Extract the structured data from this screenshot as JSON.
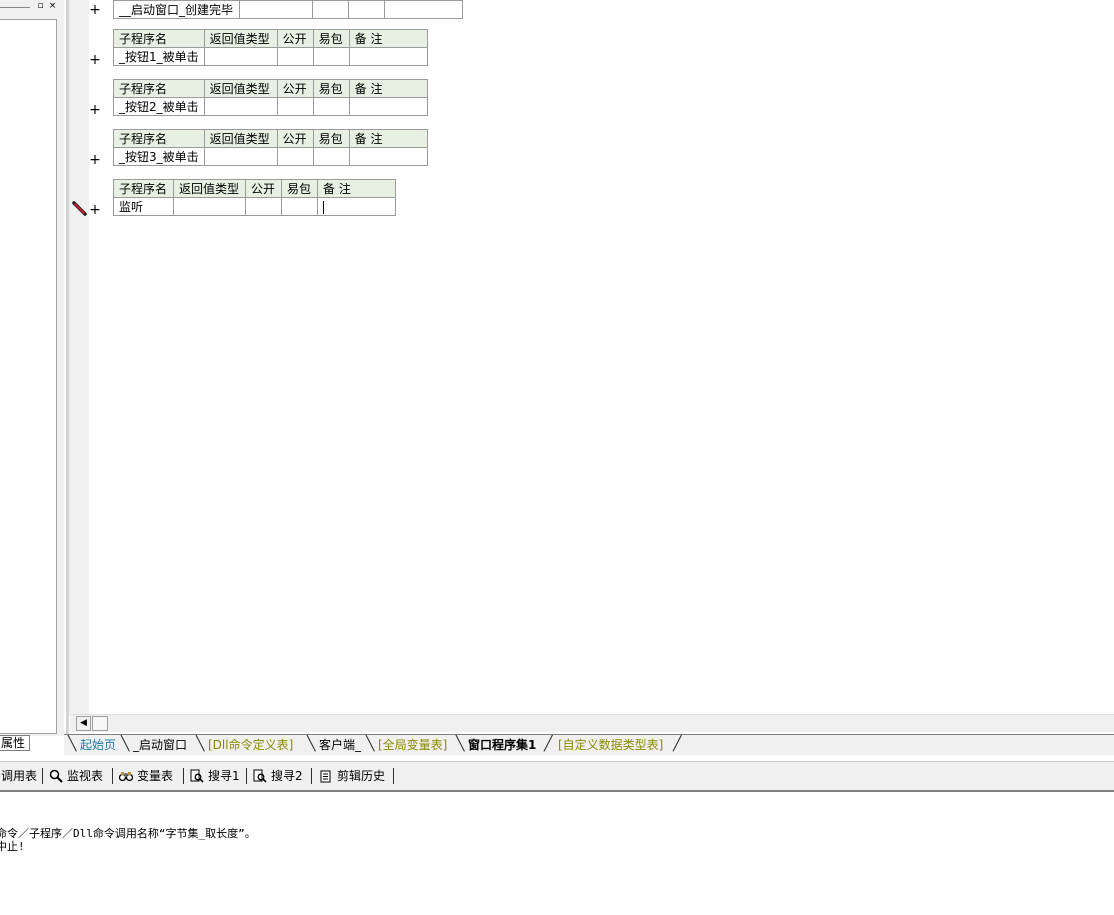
{
  "left_panel": {
    "buttons": {
      "restore": "▫",
      "close": "×"
    },
    "tab_label": "属性"
  },
  "editor": {
    "headers": {
      "name": "子程序名",
      "return_type": "返回值类型",
      "public": "公开",
      "easy_pack": "易包",
      "remarks": "备 注"
    },
    "expand_symbol": "+",
    "top_partial_row": {
      "name": "__启动窗口_创建完毕"
    },
    "subroutines": [
      {
        "name": "_按钮1_被单击"
      },
      {
        "name": "_按钮2_被单击"
      },
      {
        "name": "_按钮3_被单击"
      },
      {
        "name": "监听"
      }
    ]
  },
  "tabs": [
    {
      "label": "起始页",
      "color": "#1b7fa6"
    },
    {
      "label": "_启动窗口",
      "color": "#000000"
    },
    {
      "label": "[Dll命令定义表]",
      "color": "#8a8a00"
    },
    {
      "label": "客户端_",
      "color": "#000000"
    },
    {
      "label": "[全局变量表]",
      "color": "#8a8a00"
    },
    {
      "label": "窗口程序集1",
      "color": "#000000",
      "active": true
    },
    {
      "label": "[自定义数据类型表]",
      "color": "#8a8a00"
    }
  ],
  "toolbar": {
    "items": [
      {
        "label": "调用表",
        "icon": "call-table-icon"
      },
      {
        "label": "监视表",
        "icon": "magnifier-icon"
      },
      {
        "label": "变量表",
        "icon": "binoculars-icon"
      },
      {
        "label": "搜寻1",
        "icon": "search-doc-icon"
      },
      {
        "label": "搜寻2",
        "icon": "search-doc-icon"
      },
      {
        "label": "剪辑历史",
        "icon": "clipboard-icon"
      }
    ]
  },
  "output": {
    "line1": "命令／子程序／Dll命令调用名称“字节集_取长度”。",
    "line2": "中止!"
  }
}
